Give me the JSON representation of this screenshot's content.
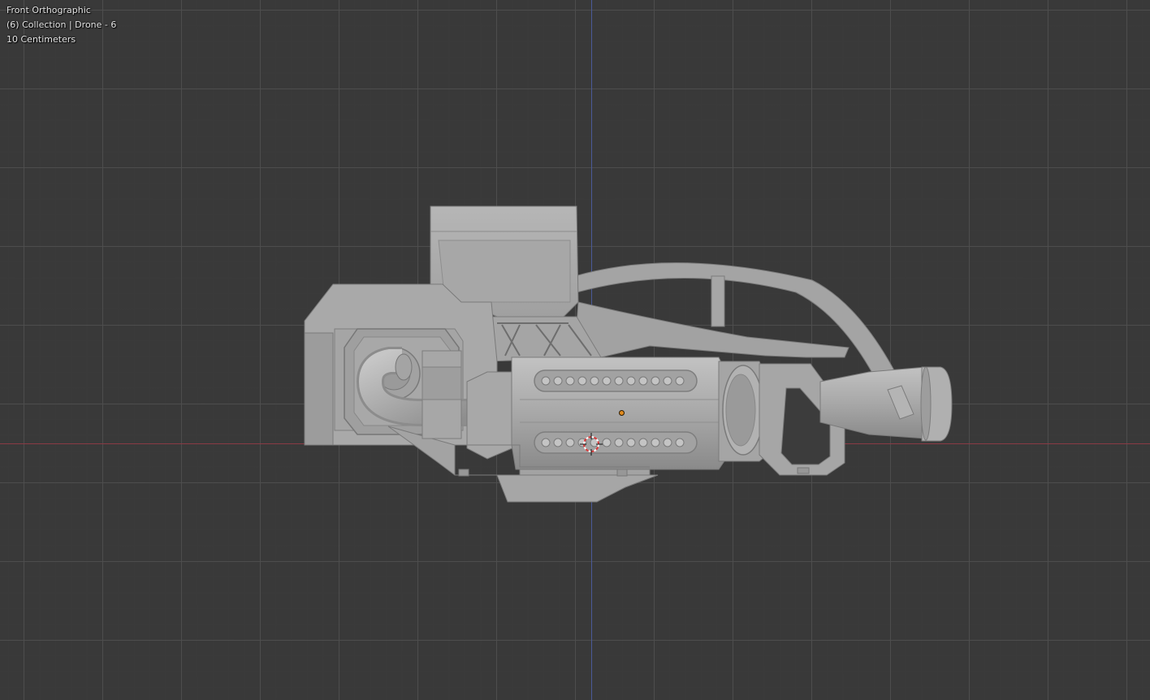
{
  "viewport": {
    "view_name": "Front Orthographic",
    "collection_info": "(6) Collection | Drone - 6",
    "grid_scale": "10 Centimeters"
  },
  "colors": {
    "background": "#393939",
    "grid_major": "#4e4e4e",
    "axis_x": "#8a3a44",
    "axis_z": "#4a5a98",
    "model_base": "#a3a3a3",
    "origin": "#e08a1e",
    "cursor_red": "#d83a3a"
  },
  "icons": {
    "cursor": "3d-cursor-icon",
    "origin": "object-origin-icon"
  }
}
